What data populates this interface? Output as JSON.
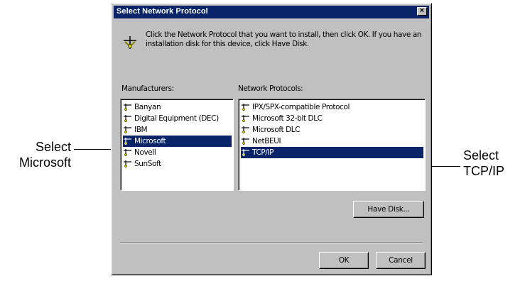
{
  "dialog": {
    "title": "Select Network Protocol",
    "close_label": "×",
    "info_text": "Click the Network Protocol that you want to install, then click OK. If you have an installation disk for this device, click Have Disk.",
    "manufacturers_label": "Manufacturers:",
    "protocols_label": "Network Protocols:",
    "manufacturers": [
      {
        "label": "Banyan",
        "selected": false
      },
      {
        "label": "Digital Equipment (DEC)",
        "selected": false
      },
      {
        "label": "IBM",
        "selected": false
      },
      {
        "label": "Microsoft",
        "selected": true
      },
      {
        "label": "Novell",
        "selected": false
      },
      {
        "label": "SunSoft",
        "selected": false
      }
    ],
    "protocols": [
      {
        "label": "IPX/SPX-compatible Protocol",
        "selected": false
      },
      {
        "label": "Microsoft 32-bit DLC",
        "selected": false
      },
      {
        "label": "Microsoft DLC",
        "selected": false
      },
      {
        "label": "NetBEUI",
        "selected": false
      },
      {
        "label": "TCP/IP",
        "selected": true
      }
    ],
    "have_disk_label": "Have Disk...",
    "ok_label": "OK",
    "cancel_label": "Cancel"
  },
  "callouts": {
    "left": [
      "Select",
      "Microsoft"
    ],
    "right": [
      "Select",
      "TCP/IP"
    ]
  },
  "colors": {
    "titlebar": "#0a246a",
    "selection": "#0a246a",
    "face": "#c0c0c0"
  },
  "icons": {
    "info": "network-info-icon",
    "item": "network-component-icon"
  }
}
